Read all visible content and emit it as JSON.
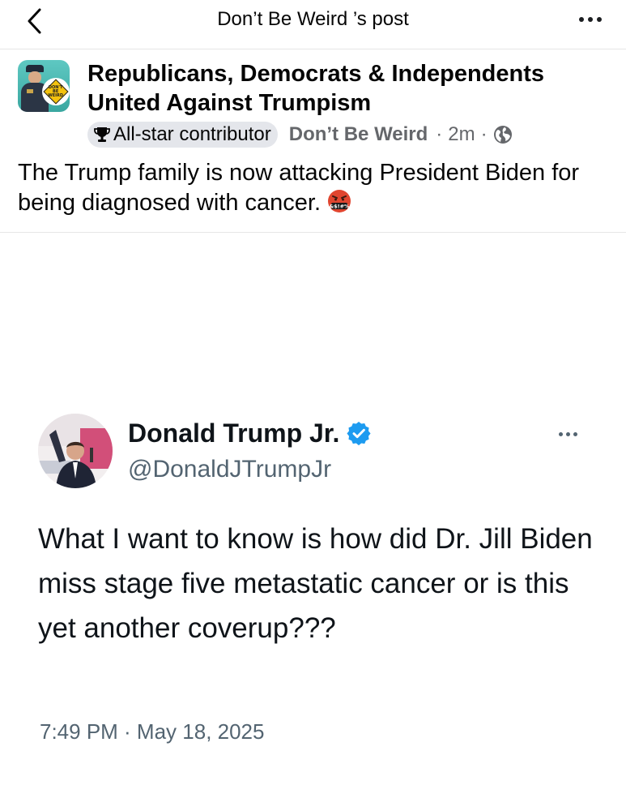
{
  "topbar": {
    "title": "Don’t Be Weird ’s post"
  },
  "group": {
    "name": "Republicans, Democrats & Independents United Against Trumpism",
    "badge_text": "DON'T BE WEIRD"
  },
  "post": {
    "contributor_badge": "All-star contributor",
    "author": "Don’t Be Weird",
    "separator": "·",
    "time": "2m",
    "text": "The Trump family is now attacking President Biden for being diagnosed with cancer."
  },
  "tweet": {
    "name": "Donald Trump Jr.",
    "handle": "@DonaldJTrumpJr",
    "text": "What I want to know is how did Dr. Jill Biden miss stage five metastatic cancer or is this yet another coverup???",
    "timestamp": "7:49 PM · May 18, 2025"
  },
  "colors": {
    "verified_blue": "#1d9bf0",
    "secondary_text": "#65676b",
    "tweet_secondary": "#536471",
    "angry_emoji": "#e0452f"
  },
  "icons": {
    "back": "chevron-left-icon",
    "more": "ellipsis-icon",
    "trophy": "trophy-icon",
    "globe": "globe-icon",
    "verified": "verified-badge-icon",
    "emoji": "angry-face-symbols-icon"
  }
}
